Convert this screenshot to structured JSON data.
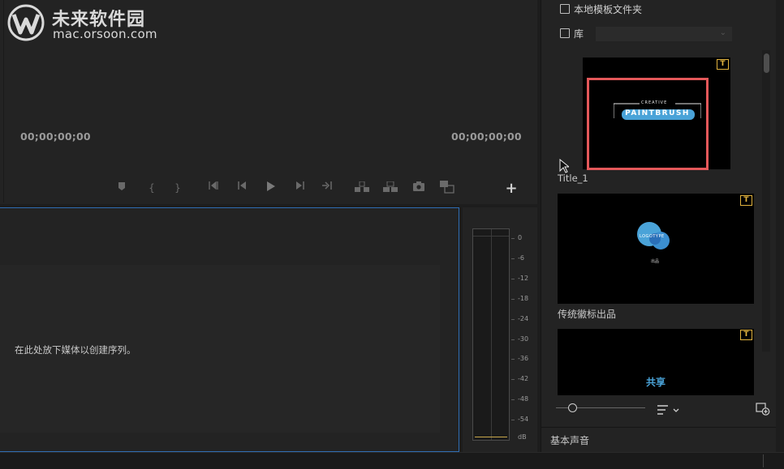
{
  "watermark": {
    "title": "未来软件园",
    "url": "mac.orsoon.com"
  },
  "program_monitor": {
    "timecode_left": "00;00;00;00",
    "timecode_right": "00;00;00;00",
    "transport_buttons": [
      "add-marker",
      "mark-in",
      "mark-out",
      "go-to-in",
      "step-back",
      "play",
      "step-forward",
      "go-to-out",
      "lift",
      "extract",
      "export-frame",
      "comparison-view"
    ],
    "add_button_label": "+"
  },
  "timeline": {
    "drop_hint": "在此处放下媒体以创建序列。"
  },
  "audio_meter": {
    "scale": [
      "0",
      "-6",
      "-12",
      "-18",
      "-24",
      "-30",
      "-36",
      "-42",
      "-48",
      "-54",
      "dB"
    ]
  },
  "right_panel": {
    "local_templates_label": "本地模板文件夹",
    "local_templates_checked": false,
    "library_label": "库",
    "library_checked": false,
    "library_select_value": "",
    "badge_glyph": "T",
    "templates": [
      {
        "name": "Title_1",
        "art_small": "CREATIVE",
        "art_big": "PAINTBRUSH",
        "highlighted": true
      },
      {
        "name": "传统徽标出品",
        "art_small": "LOGOTYPE",
        "art_sub": "出品"
      },
      {
        "name": "",
        "art_text": "共享"
      }
    ],
    "essential_sound_label": "基本声音"
  },
  "colors": {
    "accent_blue": "#2f6db3",
    "highlight_red": "#e4585a",
    "badge_gold": "#e2b33e",
    "logo_blue": "#4aa3d8"
  }
}
